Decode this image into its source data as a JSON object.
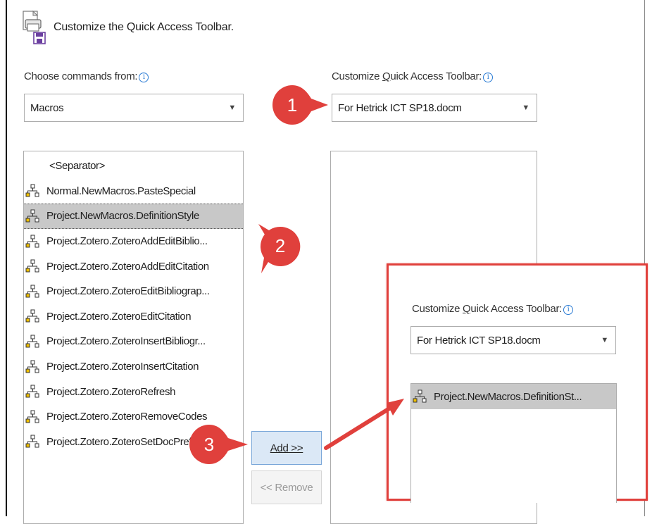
{
  "header": {
    "title": "Customize the Quick Access Toolbar."
  },
  "left": {
    "label_prefix": "Choose commands from:",
    "combo_value": "Macros",
    "items": [
      {
        "label": "<Separator>",
        "icon": ""
      },
      {
        "label": "Normal.NewMacros.PasteSpecial",
        "icon": "macro-icon"
      },
      {
        "label": "Project.NewMacros.DefinitionStyle",
        "icon": "macro-icon",
        "selected": true
      },
      {
        "label": "Project.Zotero.ZoteroAddEditBiblio...",
        "icon": "macro-icon"
      },
      {
        "label": "Project.Zotero.ZoteroAddEditCitation",
        "icon": "macro-icon"
      },
      {
        "label": "Project.Zotero.ZoteroEditBibliograp...",
        "icon": "macro-icon"
      },
      {
        "label": "Project.Zotero.ZoteroEditCitation",
        "icon": "macro-icon"
      },
      {
        "label": "Project.Zotero.ZoteroInsertBibliogr...",
        "icon": "macro-icon"
      },
      {
        "label": "Project.Zotero.ZoteroInsertCitation",
        "icon": "macro-icon"
      },
      {
        "label": "Project.Zotero.ZoteroRefresh",
        "icon": "macro-icon"
      },
      {
        "label": "Project.Zotero.ZoteroRemoveCodes",
        "icon": "macro-icon"
      },
      {
        "label": "Project.Zotero.ZoteroSetDocPrefs",
        "icon": "macro-icon"
      }
    ]
  },
  "right": {
    "label_prefix": "Customize ",
    "label_underlined": "Q",
    "label_suffix": "uick Access Toolbar:",
    "combo_value": "For Hetrick ICT SP18.docm"
  },
  "buttons": {
    "add_label": "Add >>",
    "remove_label": "<< Remove"
  },
  "inset": {
    "label_prefix": "Customize ",
    "label_underlined": "Q",
    "label_suffix": "uick Access Toolbar:",
    "combo_value": "For Hetrick ICT SP18.docm",
    "item_label": "Project.NewMacros.DefinitionSt..."
  },
  "callouts": [
    "1",
    "2",
    "3"
  ],
  "colors": {
    "callout_red": "#e0403c",
    "selection": "#c8c8c8",
    "add_button": "#dbe8f6"
  }
}
